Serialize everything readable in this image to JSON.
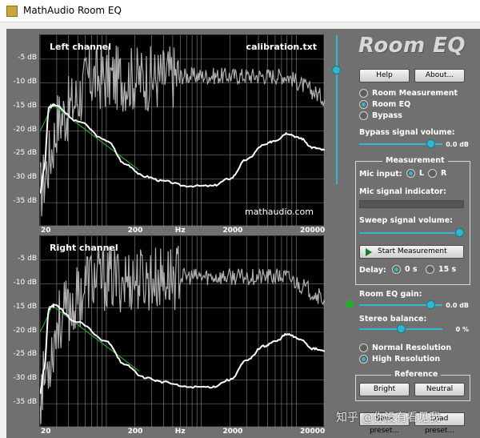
{
  "window": {
    "title": "MathAudio Room EQ"
  },
  "plots": [
    {
      "channel_label": "Left channel",
      "file_label": "calibration.txt",
      "brand_label": "mathaudio.com",
      "y_ticks": [
        "-5 dB",
        "-10 dB",
        "-15 dB",
        "-20 dB",
        "-25 dB",
        "-30 dB",
        "-35 dB"
      ],
      "x_ticks": [
        "20",
        "200",
        "Hz",
        "2000",
        "20000"
      ]
    },
    {
      "channel_label": "Right channel",
      "file_label": "",
      "brand_label": "",
      "y_ticks": [
        "-5 dB",
        "-10 dB",
        "-15 dB",
        "-20 dB",
        "-25 dB",
        "-30 dB",
        "-35 dB"
      ],
      "x_ticks": [
        "20",
        "200",
        "Hz",
        "2000",
        "20000"
      ]
    }
  ],
  "panel": {
    "logo": "Room EQ",
    "help_label": "Help",
    "about_label": "About...",
    "modes": [
      {
        "label": "Room Measurement",
        "selected": false
      },
      {
        "label": "Room EQ",
        "selected": true
      },
      {
        "label": "Bypass",
        "selected": false
      }
    ],
    "bypass_volume_label": "Bypass signal volume:",
    "bypass_volume_value": "0.0 dB",
    "bypass_volume_level": 0.9,
    "measurement": {
      "group_title": "Measurement",
      "mic_input_label": "Mic input:",
      "mic_l": "L",
      "mic_r": "R",
      "mic_selected": "L",
      "mic_indicator_label": "Mic signal indicator:",
      "sweep_volume_label": "Sweep signal volume:",
      "sweep_volume_level": 1.0,
      "start_label": "Start Measurement",
      "delay_label": "Delay:",
      "delay_0": "0 s",
      "delay_15": "15 s",
      "delay_selected": "0 s"
    },
    "gain_label": "Room EQ gain:",
    "gain_value": "0.0 dB",
    "gain_level": 0.9,
    "balance_label": "Stereo balance:",
    "balance_value": "0 %",
    "balance_level": 0.5,
    "resolution": [
      {
        "label": "Normal Resolution",
        "selected": false
      },
      {
        "label": "High Resolution",
        "selected": true
      }
    ],
    "reference": {
      "group_title": "Reference",
      "bright_label": "Bright",
      "neutral_label": "Neutral"
    },
    "save_label": "Save preset...",
    "load_label": "Load preset..."
  },
  "output_level": 0.78,
  "watermark": "知乎 @你没有看见我",
  "colors": {
    "accent": "#2fb8cf",
    "panel_bg": "#707070",
    "measured": "#b0b0b0",
    "eq_curve": "#ffffff",
    "target": "#22b022"
  }
}
